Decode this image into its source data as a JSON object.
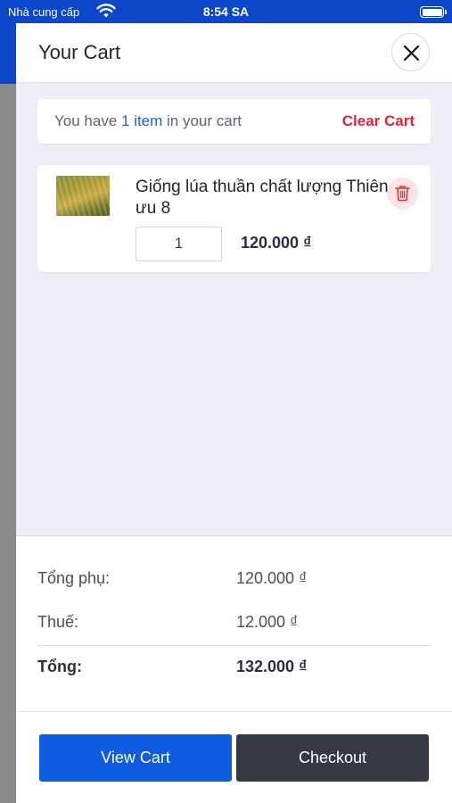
{
  "status_bar": {
    "carrier": "Nhà cung cấp",
    "time": "8:54 SA"
  },
  "cart": {
    "title": "Your Cart",
    "info": {
      "prefix": "You have ",
      "count_text": "1 item",
      "suffix": " in your cart",
      "clear_label": "Clear Cart"
    },
    "items": [
      {
        "name": "Giống lúa thuần chất lượng Thiên ưu 8",
        "quantity": "1",
        "price": "120.000 ₫"
      }
    ]
  },
  "summary": {
    "subtotal_label": "Tổng phụ:",
    "subtotal_value": "120.000 ₫",
    "tax_label": "Thuế:",
    "tax_value": "12.000 ₫",
    "total_label": "Tổng:",
    "total_value": "132.000 ₫"
  },
  "actions": {
    "view_cart_label": "View Cart",
    "checkout_label": "Checkout"
  },
  "colors": {
    "brand_blue": "#0e5ce0",
    "danger_red": "#d8283b",
    "dark_button": "#353a42"
  }
}
